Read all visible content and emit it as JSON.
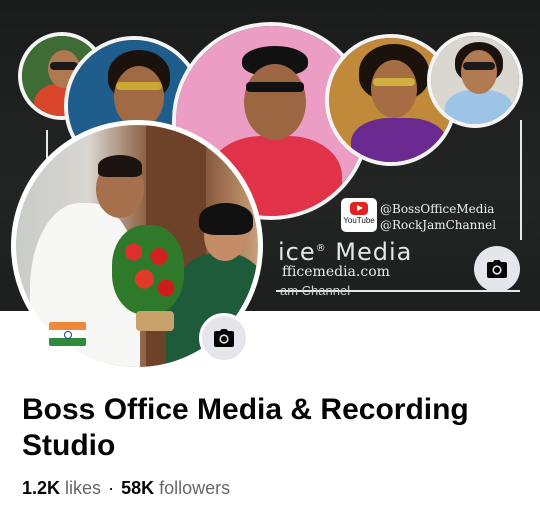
{
  "cover": {
    "brand_text": "ice",
    "brand_suffix": "Media",
    "trademark": "®",
    "url_text": "fficemedia.com",
    "channel_text": "am Channel",
    "youtube_badge": "YouTube",
    "handles": [
      "@BossOfficeMedia",
      "@RockJamChannel"
    ],
    "camera_icon": "camera-icon"
  },
  "avatar": {
    "camera_icon": "camera-icon",
    "flag": "india-flag"
  },
  "page": {
    "name": "Boss Office Media & Recording Studio",
    "likes_count": "1.2K",
    "likes_label": "likes",
    "separator": "·",
    "followers_count": "58K",
    "followers_label": "followers"
  },
  "colors": {
    "cover_bg": "#1d1f1e",
    "camera_button_bg": "#e4e6eb",
    "text_primary": "#050505",
    "text_secondary": "#65676b"
  }
}
